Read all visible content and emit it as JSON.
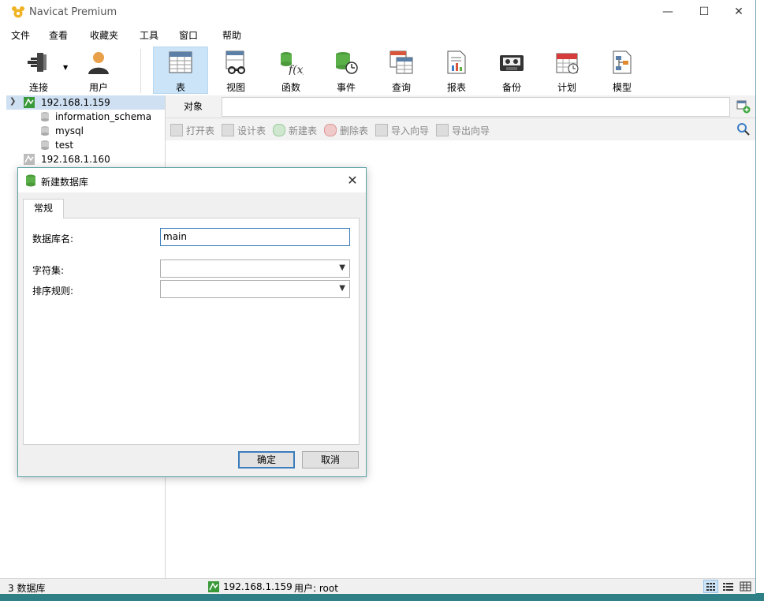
{
  "window": {
    "title": "Navicat Premium",
    "minimize_glyph": "—",
    "maximize_glyph": "☐",
    "close_glyph": "✕"
  },
  "menu": [
    "文件",
    "查看",
    "收藏夹",
    "工具",
    "窗口",
    "帮助"
  ],
  "toolbar": {
    "connect": "连接",
    "user": "用户",
    "table": "表",
    "view": "视图",
    "function": "函数",
    "event": "事件",
    "query": "查询",
    "report": "报表",
    "backup": "备份",
    "schedule": "计划",
    "model": "模型",
    "active": "表"
  },
  "tree": {
    "connections": [
      {
        "name": "192.168.1.159",
        "expanded": true,
        "databases": [
          "information_schema",
          "mysql",
          "test"
        ]
      },
      {
        "name": "192.168.1.160",
        "expanded": false,
        "databases": []
      }
    ]
  },
  "object_tab": {
    "label": "对象"
  },
  "object_tools": [
    "打开表",
    "设计表",
    "新建表",
    "删除表",
    "导入向导",
    "导出向导"
  ],
  "dialog": {
    "title": "新建数据库",
    "tab": "常规",
    "db_name_label": "数据库名:",
    "db_name_value": "main",
    "charset_label": "字符集:",
    "charset_value": "",
    "collation_label": "排序规则:",
    "collation_value": "",
    "ok": "确定",
    "cancel": "取消"
  },
  "status": {
    "db_count": "3 数据库",
    "connection": "192.168.1.159",
    "user": "用户: root"
  },
  "colors": {
    "accent": "#cce4f7",
    "desktop": "#3a8f8a"
  }
}
